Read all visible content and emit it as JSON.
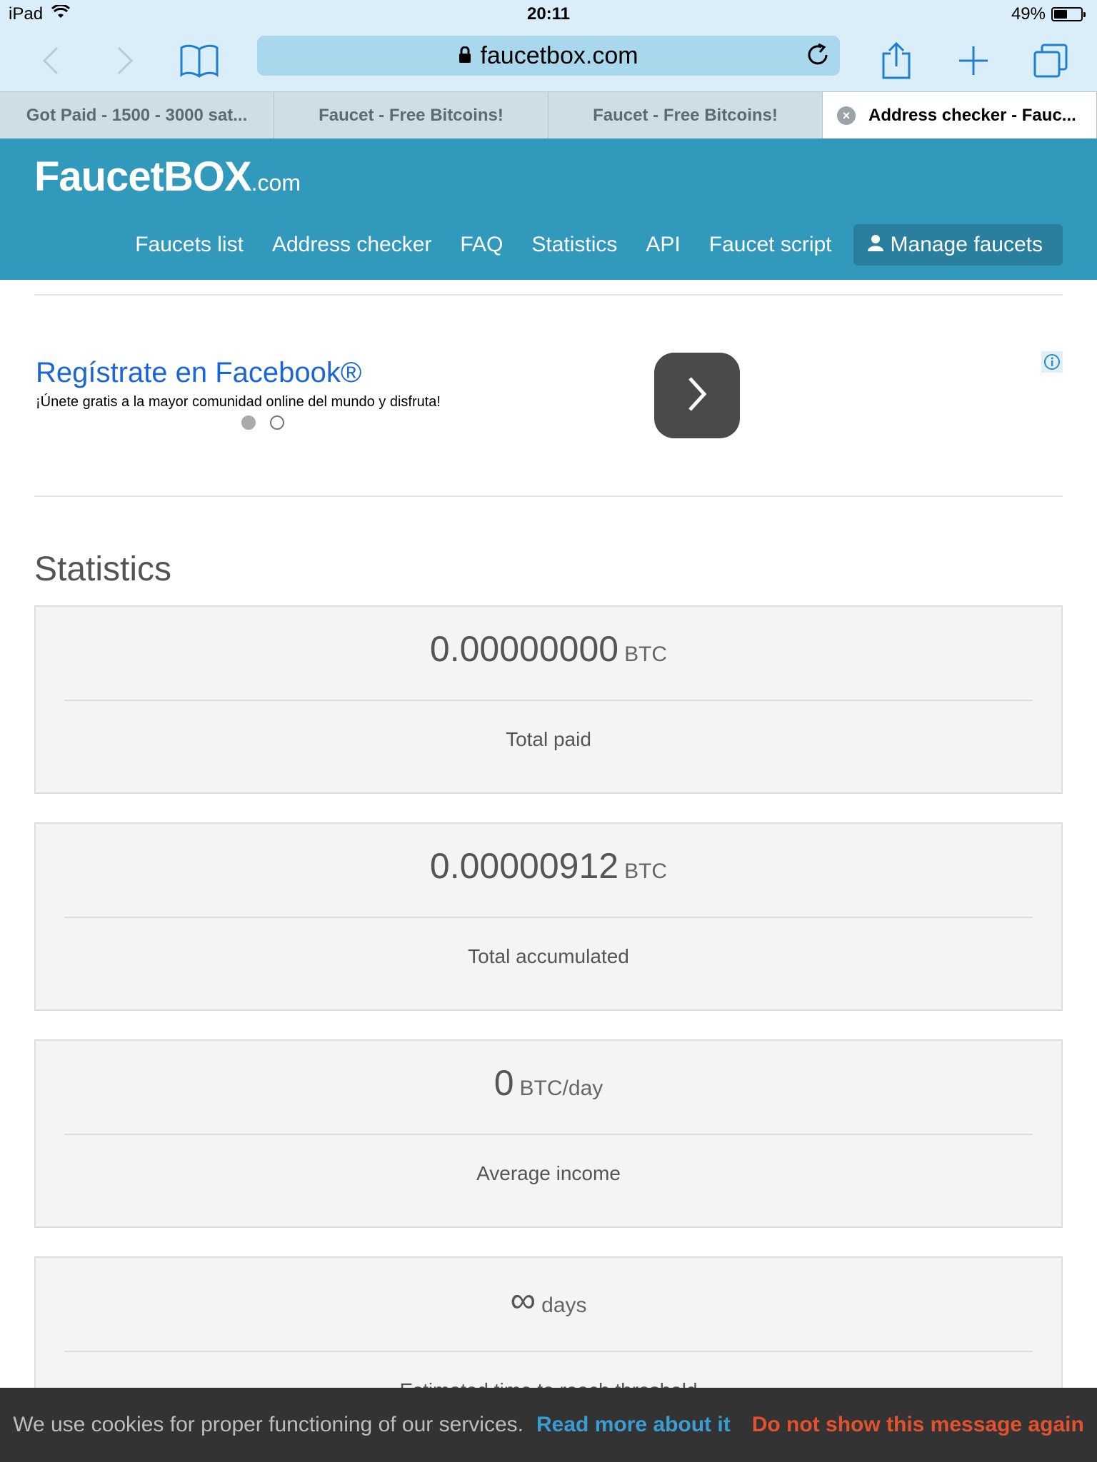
{
  "status_bar": {
    "device": "iPad",
    "time": "20:11",
    "battery": "49%"
  },
  "browser": {
    "url": "faucetbox.com",
    "tabs": [
      {
        "title": "Got Paid - 1500 - 3000 sat..."
      },
      {
        "title": "Faucet - Free Bitcoins!"
      },
      {
        "title": "Faucet - Free Bitcoins!"
      },
      {
        "title": "Address checker - Fauc..."
      }
    ]
  },
  "site": {
    "logo_main": "FaucetBOX",
    "logo_suffix": ".com",
    "nav": [
      "Faucets list",
      "Address checker",
      "FAQ",
      "Statistics",
      "API",
      "Faucet script"
    ],
    "manage_label": "Manage faucets"
  },
  "ad": {
    "title": "Regístrate en Facebook®",
    "subtitle": "¡Únete gratis a la mayor comunidad online del mundo y disfruta!"
  },
  "section_title": "Statistics",
  "stats": [
    {
      "value": "0.00000000",
      "unit": "BTC",
      "label": "Total paid"
    },
    {
      "value": "0.00000912",
      "unit": "BTC",
      "label": "Total accumulated"
    },
    {
      "value": "0",
      "unit": "BTC/day",
      "label": "Average income"
    },
    {
      "value": "∞",
      "unit": "days",
      "label": "Estimated time to reach threshold"
    }
  ],
  "cookie": {
    "text": "We use cookies for proper functioning of our services.",
    "read_more": "Read more about it",
    "dismiss": "Do not show this message again"
  },
  "colors": {
    "header_bg": "#3199bc",
    "toolbar_bg": "#d9eef8",
    "accent_link": "#1a66d8",
    "cookie_read": "#3a9cd0",
    "cookie_dismiss": "#e2522f"
  }
}
